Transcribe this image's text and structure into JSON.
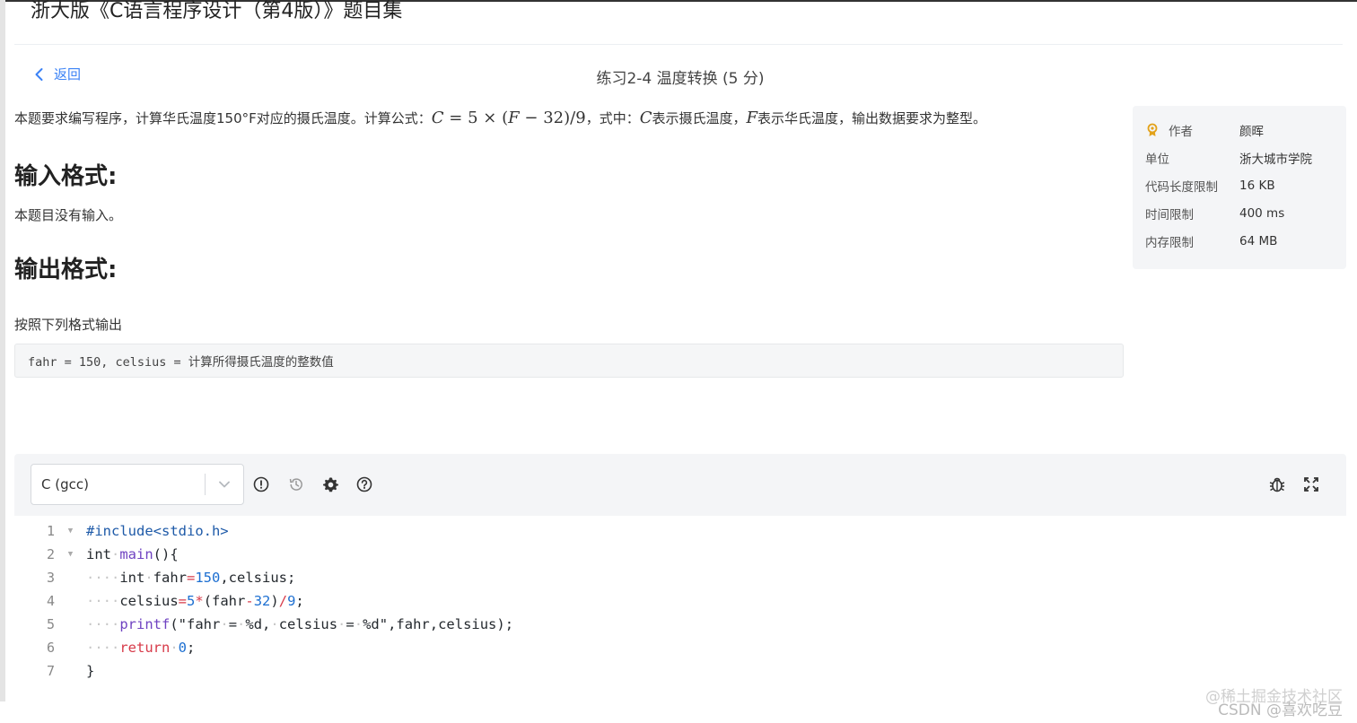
{
  "header": {
    "set_title": "浙大版《C语言程序设计（第4版）》题目集",
    "back_label": "返回",
    "problem_title": "练习2-4 温度转换 (5 分)"
  },
  "problem": {
    "intro_prefix": "本题要求编写程序，计算华氏温度150°F对应的摄氏温度。计算公式：",
    "formula_parts": [
      "C",
      "=",
      "5",
      "×",
      "(",
      "F",
      "−",
      "32",
      ")",
      "/",
      "9"
    ],
    "intro_middle1": "，式中：",
    "var_c": "C",
    "intro_middle2": "表示摄氏温度，",
    "var_f": "F",
    "intro_suffix": "表示华氏温度，输出数据要求为整型。",
    "input_heading": "输入格式:",
    "input_desc": "本题目没有输入。",
    "output_heading": "输出格式:",
    "output_desc": "按照下列格式输出",
    "output_sample": "fahr = 150, celsius = 计算所得摄氏温度的整数值"
  },
  "info": {
    "author_label": "作者",
    "author_value": "颜晖",
    "unit_label": "单位",
    "unit_value": "浙大城市学院",
    "code_limit_label": "代码长度限制",
    "code_limit_value": "16 KB",
    "time_limit_label": "时间限制",
    "time_limit_value": "400 ms",
    "memory_limit_label": "内存限制",
    "memory_limit_value": "64 MB",
    "medal_color": "#e3a21a"
  },
  "editor": {
    "language": "C (gcc)",
    "toolbar_icons": [
      "info-icon",
      "history-icon",
      "settings-icon",
      "help-icon",
      "debug-icon",
      "fullscreen-icon"
    ],
    "code_lines": [
      "#include<stdio.h>",
      "int main(){",
      "    int fahr=150,celsius;",
      "    celsius=5*(fahr-32)/9;",
      "    printf(\"fahr = %d, celsius = %d\",fahr,celsius);",
      "    return 0;",
      "}"
    ],
    "line_numbers": [
      "1",
      "2",
      "3",
      "4",
      "5",
      "6",
      "7"
    ]
  },
  "watermark": {
    "line1": "@稀土掘金技术社区",
    "line2": "CSDN @喜欢吃豆"
  }
}
